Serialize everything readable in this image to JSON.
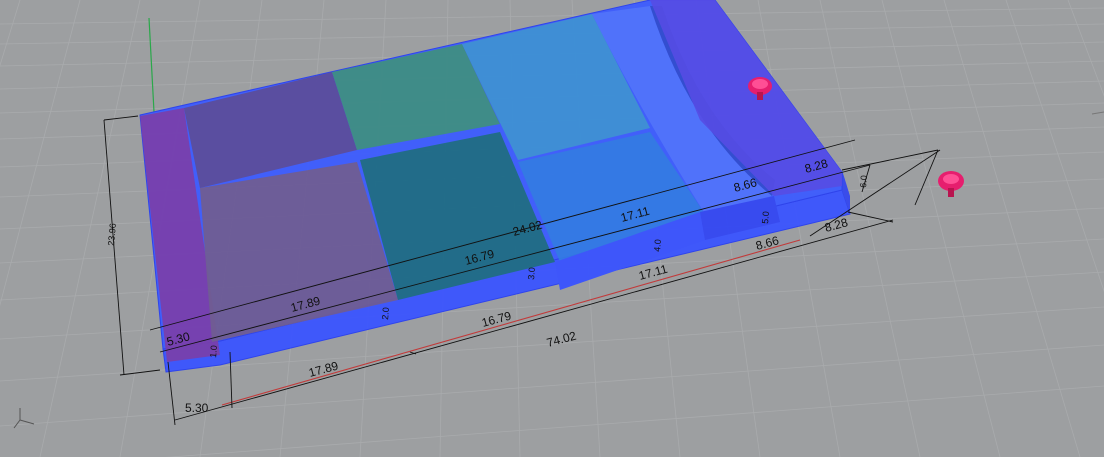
{
  "scene": {
    "colors": {
      "background": "#9d9fa1",
      "grid": "#a9abad",
      "box_blue": "#3b55ff",
      "purple_face": "#7a3aa8",
      "teal_face": "#1f7f86",
      "mauve_face": "#6c5a92",
      "sky_face": "#3a8ed8",
      "marker": "#e61e6e"
    },
    "dims": {
      "front_total": "74.02",
      "front_a": "5.30",
      "front_b": "17.89",
      "front_c": "16.79",
      "front_d": "17.11",
      "front_e": "8.66",
      "front_f": "8.28",
      "back_total": "24.02",
      "back_a": "5.30",
      "back_b": "17.89",
      "back_c": "16.79",
      "back_d": "17.11",
      "back_e": "8.66",
      "back_f": "8.28",
      "depth": "23.96",
      "h1": "1.0",
      "h2": "2.0",
      "h3": "3.0",
      "h4": "4.0",
      "h5": "5.0",
      "h6": "6.0"
    },
    "axis_icon": "axis-triad-icon",
    "marker_icons": [
      "pin-marker-icon",
      "pin-marker-icon"
    ]
  }
}
